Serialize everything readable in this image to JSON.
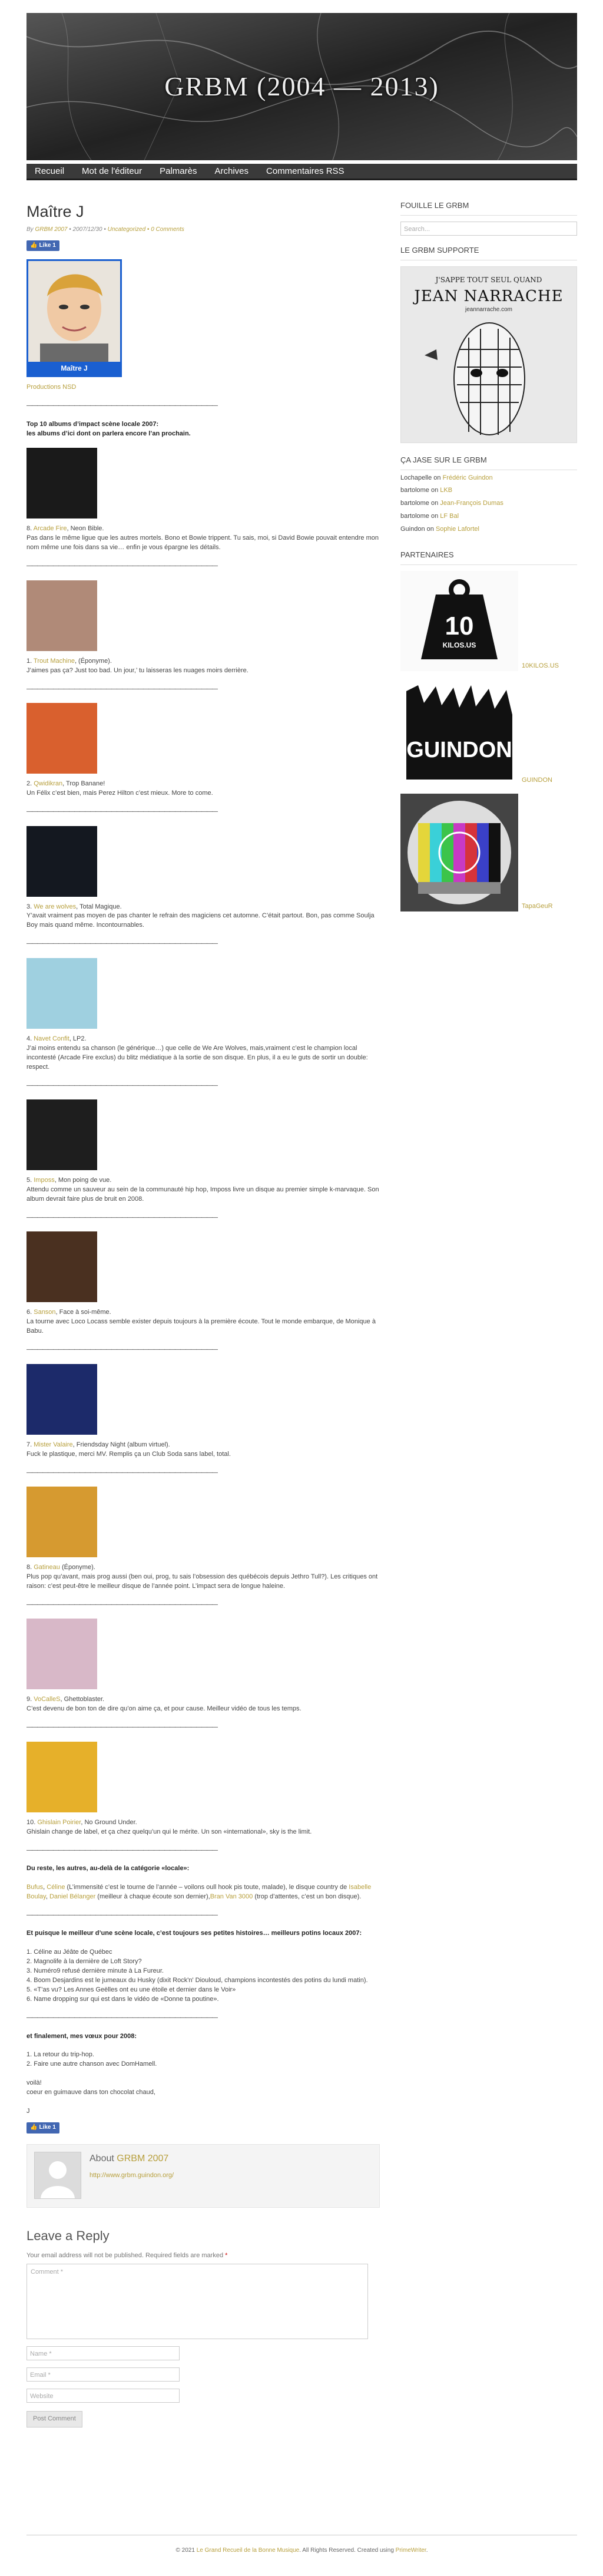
{
  "header": {
    "site_title": "GRBM (2004 — 2013)"
  },
  "nav": [
    "Recueil",
    "Mot de l'éditeur",
    "Palmarès",
    "Archives",
    "Commentaires RSS"
  ],
  "post": {
    "title": "Maître J",
    "meta_by": "By",
    "meta_author": "GRBM 2007",
    "meta_date": "• 2007/12/30 •",
    "meta_category": "Uncategorized",
    "meta_comments": "• 0 Comments",
    "fb_label": "Like 1",
    "image_caption": "Maître J",
    "credit_link": "Productions NSD",
    "separator": "————————————————————————————————————",
    "intro_line1": "Top 10 albums d’impact scène locale 2007:",
    "intro_line2": "les albums d’ici dont on parlera encore l’an prochain.",
    "albums": [
      {
        "rank": "8.",
        "artist": "Arcade Fire",
        "title": ", Neon Bible.",
        "text": "Pas dans le même ligue que les autres mortels. Bono et Bowie trippent. Tu sais, moi, si David Bowie pouvait entendre mon nom même une fois dans sa vie… enfin je vous épargne les détails.",
        "color": "#1a1a1a"
      },
      {
        "rank": "1.",
        "artist": "Trout Machine",
        "title": ", (Éponyme).",
        "text": "J’aimes pas ça? Just too bad. Un jour,’ tu laisseras les nuages moirs derrière.",
        "color": "#b08a78"
      },
      {
        "rank": "2.",
        "artist": "Qwidikran",
        "title": ", Trop Banane!",
        "text": "Un Félix c’est bien, mais Perez Hilton c’est mieux. More to come.",
        "color": "#d9602e"
      },
      {
        "rank": "3.",
        "artist": "We are wolves",
        "title": ", Total Magique.",
        "text": "Y’avait vraiment pas moyen de pas chanter le refrain des magiciens cet automne. C’était partout. Bon, pas comme Soulja Boy mais quand même. Incontournables.",
        "color": "#141820"
      },
      {
        "rank": "4.",
        "artist": "Navet Confit",
        "title": ", LP2.",
        "text": "J’ai moins entendu sa chanson (le générique…) que celle de We Are Wolves, mais,vraiment c’est le champion local incontesté (Arcade Fire exclus) du blitz médiatique à la sortie de son disque. En plus, il a eu le guts de sortir un double: respect.",
        "color": "#9fd0e0"
      },
      {
        "rank": "5.",
        "artist": "Imposs",
        "title": ", Mon poing de vue.",
        "text": "Attendu comme un sauveur au sein de la communauté hip hop, Imposs livre un disque au premier simple k-marvaque. Son album devrait faire plus de bruit en 2008.",
        "color": "#1e1e1e"
      },
      {
        "rank": "6.",
        "artist": "Sanson",
        "title": ", Face à soi-même.",
        "text": "La tourne avec Loco Locass semble exister depuis toujours à la première écoute. Tout le monde embarque, de Monique à Babu.",
        "color": "#4a3020"
      },
      {
        "rank": "7.",
        "artist": "Mister Valaire",
        "title": ", Friendsday Night (album virtuel).",
        "text": "Fuck le plastique, merci MV. Remplis ça un Club Soda sans label, total.",
        "color": "#1c2a6a"
      },
      {
        "rank": "8.",
        "artist": "Gatineau",
        "title": " (Éponyme).",
        "text": "Plus pop qu’avant, mais prog aussi (ben oui, prog, tu sais l’obsession des québécois depuis Jethro Tull?). Les critiques ont raison: c’est peut-être le meilleur disque de l’année point. L’impact sera de longue haleine.",
        "color": "#d69a30"
      },
      {
        "rank": "9.",
        "artist": "VoCalleS",
        "title": ", Ghettoblaster.",
        "text": "C’est devenu de bon ton de dire qu’on aime ça, et pour cause. Meilleur vidéo de tous les temps.",
        "color": "#d8b8c8"
      },
      {
        "rank": "10.",
        "artist": "Ghislain Poirier",
        "title": ", No Ground Under.",
        "text": "Ghislain change de label, et ça chez quelqu’un qui le mérite. Un son «international», sky is the limit.",
        "color": "#e6b02a"
      }
    ],
    "du_reste_title": "Du reste, les autres, au-delà de la catégorie «locale»:",
    "du_reste_p1_a": "Bufus",
    "du_reste_p1_b": ", ",
    "du_reste_p1_c": "Céline",
    "du_reste_p1_d": " (L’immensité c’est le tourne de l’année – voilons oull hook pis toute, malade), le disque country de ",
    "du_reste_p1_e": "Isabelle Boulay",
    "du_reste_p1_f": ", ",
    "du_reste_p1_g": "Daniel Bélanger",
    "du_reste_p1_h": " (meilleur à chaque écoute son dernier),",
    "du_reste_p1_i": "Bran Van 3000",
    "du_reste_p1_j": " (trop d’attentes, c’est un bon disque).",
    "pire_title": "Et puisque le meilleur d’une scène locale, c’est toujours ses petites histoires… meilleurs potins locaux 2007:",
    "pire_list": [
      "1. Céline au Jéâte de Québec",
      "2. Magnolife à la dernière de Loft Story?",
      "3. Numéro9 refusé dernière minute à La Fureur.",
      "4. Boom Desjardins est le jumeaux du Husky (dixit Rock'n' Diouloud, champions incontestés des potins du lundi matin).",
      "5. «T’as vu? Les Annes Geëlles ont eu une étoile et dernier dans le Voir»",
      "6. Name dropping sur qui est dans le vidéo de «Donne ta poutine»."
    ],
    "final_title": "et finalement, mes vœux pour 2008:",
    "final_list": [
      "1. La retour du trip-hop.",
      "2. Faire une autre chanson avec DomHamell."
    ],
    "voila": "voilà!",
    "coeur": "coeur en guimauve dans ton chocolat chaud,",
    "sig": "J",
    "fb_label2": "Like 1",
    "about_label": "About",
    "about_name": "GRBM 2007",
    "about_link": "http://www.grbm.guindon.org/",
    "reply_title": "Leave a Reply",
    "reply_req": "Your email address will not be published. Required fields are marked",
    "reply_req_star": "*",
    "comment_placeholder": "Comment *",
    "name_placeholder": "Name *",
    "email_placeholder": "Email *",
    "website_placeholder": "Website",
    "submit_label": "Post Comment"
  },
  "sidebar": {
    "search_title": "FOUILLE LE GRBM",
    "search_placeholder": "Search...",
    "support_title": "LE GRBM SUPPORTE",
    "poster_top": "J'SAPPE TOUT SEUL QUAND",
    "poster_name": "JEAN NARRACHE",
    "poster_url": "jeannarrache.com",
    "comments_title": "ÇA JASE SUR LE GRBM",
    "comments": [
      {
        "who": "Lochapelle",
        "on": "on",
        "post": "Frédéric Guindon"
      },
      {
        "who": "bartolome",
        "on": "on",
        "post": "LKB"
      },
      {
        "who": "bartolome",
        "on": "on",
        "post": "Jean-François Dumas"
      },
      {
        "who": "bartolome",
        "on": "on",
        "post": "LF Bal"
      },
      {
        "who": "Guindon",
        "on": "on",
        "post": "Sophie Lafortel"
      }
    ],
    "partners_title": "PARTENAIRES",
    "partners": [
      {
        "label": "10KILOS.US"
      },
      {
        "label": "GUINDON"
      },
      {
        "label": "TapaGeuR"
      }
    ],
    "kilos_text": "10",
    "kilos_sub": "KILOS.US",
    "guindon_text": "GUINDON"
  },
  "footer": {
    "prefix": "© 2021",
    "site_link": "Le Grand Recueil de la Bonne Musique",
    "middle": ". All Rights Reserved. Created using",
    "theme_link": "PrimeWriter",
    "end": "."
  },
  "colors": {
    "accent": "#b79f3c",
    "nav": "#3a3a3a",
    "fb": "#4267b2"
  }
}
